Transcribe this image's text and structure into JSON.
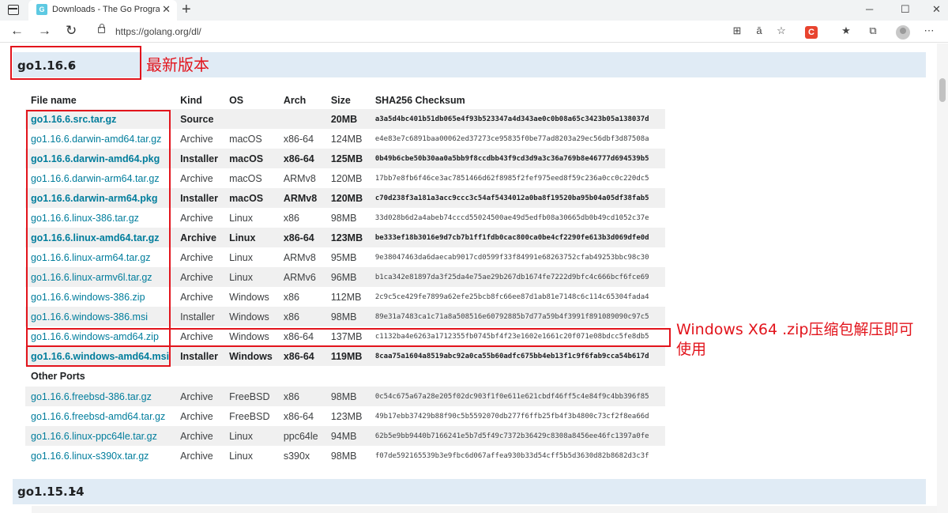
{
  "browser": {
    "tab_title": "Downloads - The Go Programming Language",
    "url": "https://golang.org/dl/",
    "new_tab": "+",
    "close": "✕",
    "ext_label": "C"
  },
  "releases": [
    {
      "title": "go1.16.6",
      "toggle": "▾"
    },
    {
      "title": "go1.15.14",
      "toggle": "▸"
    }
  ],
  "table": {
    "headers": [
      "File name",
      "Kind",
      "OS",
      "Arch",
      "Size",
      "SHA256 Checksum"
    ],
    "rows": [
      {
        "file": "go1.16.6.src.tar.gz",
        "kind": "Source",
        "os": "",
        "arch": "",
        "size": "20MB",
        "sha": "a3a5d4bc401b51db065e4f93b523347a4d343ae0c0b08a65c3423b05a138037d",
        "highlight": true
      },
      {
        "file": "go1.16.6.darwin-amd64.tar.gz",
        "kind": "Archive",
        "os": "macOS",
        "arch": "x86-64",
        "size": "124MB",
        "sha": "e4e83e7c6891baa00062ed37273ce95835f0be77ad8203a29ec56dbf3d87508a",
        "highlight": false
      },
      {
        "file": "go1.16.6.darwin-amd64.pkg",
        "kind": "Installer",
        "os": "macOS",
        "arch": "x86-64",
        "size": "125MB",
        "sha": "0b49b6cbe50b30aa0a5bb9f8ccdbb43f9cd3d9a3c36a769b8e46777d694539b5",
        "highlight": true
      },
      {
        "file": "go1.16.6.darwin-arm64.tar.gz",
        "kind": "Archive",
        "os": "macOS",
        "arch": "ARMv8",
        "size": "120MB",
        "sha": "17bb7e8fb6f46ce3ac7851466d62f8985f2fef975eed8f59c236a0cc0c220dc5",
        "highlight": false
      },
      {
        "file": "go1.16.6.darwin-arm64.pkg",
        "kind": "Installer",
        "os": "macOS",
        "arch": "ARMv8",
        "size": "120MB",
        "sha": "c70d238f3a181a3acc9ccc3c54af5434012a0ba8f19520ba95b04a05df38fab5",
        "highlight": true
      },
      {
        "file": "go1.16.6.linux-386.tar.gz",
        "kind": "Archive",
        "os": "Linux",
        "arch": "x86",
        "size": "98MB",
        "sha": "33d028b6d2a4abeb74cccd55024500ae49d5edfb08a30665db0b49cd1052c37e",
        "highlight": false
      },
      {
        "file": "go1.16.6.linux-amd64.tar.gz",
        "kind": "Archive",
        "os": "Linux",
        "arch": "x86-64",
        "size": "123MB",
        "sha": "be333ef18b3016e9d7cb7b1ff1fdb0cac800ca0be4cf2290fe613b3d069dfe0d",
        "highlight": true
      },
      {
        "file": "go1.16.6.linux-arm64.tar.gz",
        "kind": "Archive",
        "os": "Linux",
        "arch": "ARMv8",
        "size": "95MB",
        "sha": "9e38047463da6daecab9017cd0599f33f84991e68263752cfab49253bbc98c30",
        "highlight": false
      },
      {
        "file": "go1.16.6.linux-armv6l.tar.gz",
        "kind": "Archive",
        "os": "Linux",
        "arch": "ARMv6",
        "size": "96MB",
        "sha": "b1ca342e81897da3f25da4e75ae29b267db1674fe7222d9bfc4c666bcf6fce69",
        "highlight": false
      },
      {
        "file": "go1.16.6.windows-386.zip",
        "kind": "Archive",
        "os": "Windows",
        "arch": "x86",
        "size": "112MB",
        "sha": "2c9c5ce429fe7899a62efe25bcb8fc66ee87d1ab81e7148c6c114c65304fada4",
        "highlight": false
      },
      {
        "file": "go1.16.6.windows-386.msi",
        "kind": "Installer",
        "os": "Windows",
        "arch": "x86",
        "size": "98MB",
        "sha": "89e31a7483ca1c71a8a508516e60792885b7d77a59b4f3991f891089090c97c5",
        "highlight": false
      },
      {
        "file": "go1.16.6.windows-amd64.zip",
        "kind": "Archive",
        "os": "Windows",
        "arch": "x86-64",
        "size": "137MB",
        "sha": "c1132ba4e6263a1712355fb0745bf4f23e1602e1661c20f071e08bdcc5fe8db5",
        "highlight": false
      },
      {
        "file": "go1.16.6.windows-amd64.msi",
        "kind": "Installer",
        "os": "Windows",
        "arch": "x86-64",
        "size": "119MB",
        "sha": "8caa75a1604a8519abc92a0ca55b60adfc675bb4eb13f1c9f6fab9cca54b617d",
        "highlight": true
      }
    ],
    "other_ports_label": "Other Ports",
    "other_rows": [
      {
        "file": "go1.16.6.freebsd-386.tar.gz",
        "kind": "Archive",
        "os": "FreeBSD",
        "arch": "x86",
        "size": "98MB",
        "sha": "0c54c675a67a28e205f02dc903f1f0e611e621cbdf46ff5c4e84f9c4bb396f85"
      },
      {
        "file": "go1.16.6.freebsd-amd64.tar.gz",
        "kind": "Archive",
        "os": "FreeBSD",
        "arch": "x86-64",
        "size": "123MB",
        "sha": "49b17ebb37429b88f90c5b5592070db277f6ffb25fb4f3b4800c73cf2f8ea66d"
      },
      {
        "file": "go1.16.6.linux-ppc64le.tar.gz",
        "kind": "Archive",
        "os": "Linux",
        "arch": "ppc64le",
        "size": "94MB",
        "sha": "62b5e9bb9440b7166241e5b7d5f49c7372b36429c8308a8456ee46fc1397a0fe"
      },
      {
        "file": "go1.16.6.linux-s390x.tar.gz",
        "kind": "Archive",
        "os": "Linux",
        "arch": "s390x",
        "size": "98MB",
        "sha": "f07de592165539b3e9fbc6d067affea930b33d54cff5b5d3630d82b8682d3c3f"
      }
    ]
  },
  "annotations": {
    "latest": "最新版本",
    "windows_line1": "Windows X64 .zip压缩包解压即可",
    "windows_line2": "使用"
  },
  "colors": {
    "annotation": "#e2141c",
    "link": "#007d9c",
    "header_bg": "#e0ebf5"
  }
}
